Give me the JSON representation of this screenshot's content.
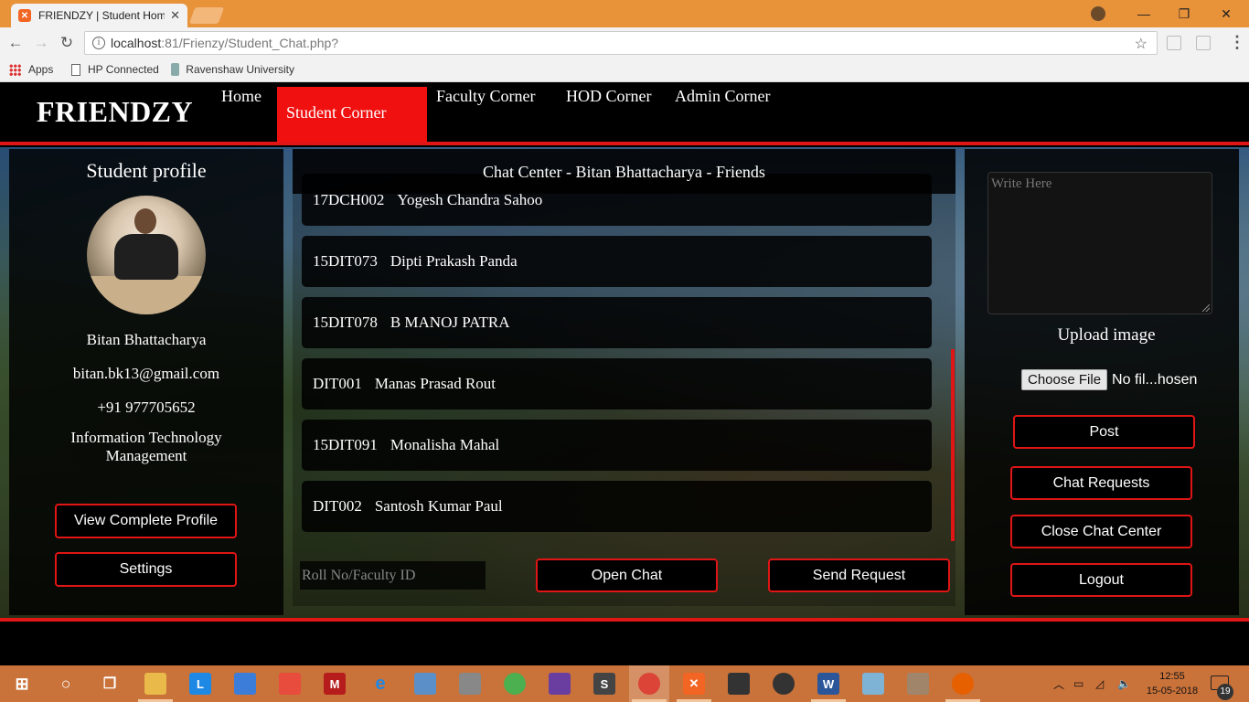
{
  "browser": {
    "tab_title": "FRIENDZY | Student Hom",
    "url_host": "localhost",
    "url_port_path": ":81/Frienzy/Student_Chat.php?",
    "bookmarks": [
      {
        "label": "Apps"
      },
      {
        "label": "HP Connected"
      },
      {
        "label": "Ravenshaw University"
      }
    ],
    "window_controls": {
      "minimize": "—",
      "restore": "❐",
      "close": "✕"
    }
  },
  "nav": {
    "brand": "FRIENDZY",
    "links": [
      "Home",
      "Student Corner",
      "Faculty Corner",
      "HOD Corner",
      "Admin Corner"
    ],
    "active": "Student Corner"
  },
  "profile": {
    "heading": "Student profile",
    "name": "Bitan Bhattacharya",
    "email": "bitan.bk13@gmail.com",
    "phone": "+91 977705652",
    "department": "Information Technology Management",
    "view_profile_label": "View Complete Profile",
    "settings_label": "Settings"
  },
  "chat": {
    "header": "Chat Center - Bitan Bhattacharya - Friends",
    "friends": [
      {
        "id": "17DCH002",
        "name": "Yogesh Chandra Sahoo"
      },
      {
        "id": "15DIT073",
        "name": "Dipti Prakash Panda"
      },
      {
        "id": "15DIT078",
        "name": "B MANOJ PATRA"
      },
      {
        "id": "DIT001",
        "name": "Manas Prasad Rout"
      },
      {
        "id": "15DIT091",
        "name": "Monalisha Mahal"
      },
      {
        "id": "DIT002",
        "name": "Santosh Kumar Paul"
      }
    ],
    "id_placeholder": "Roll No/Faculty ID",
    "open_chat_label": "Open Chat",
    "send_request_label": "Send Request"
  },
  "post": {
    "placeholder": "Write Here",
    "upload_label": "Upload image",
    "choose_file_label": "Choose File",
    "file_status": "No fil...hosen",
    "post_label": "Post",
    "chat_requests_label": "Chat Requests",
    "close_chat_label": "Close Chat Center",
    "logout_label": "Logout"
  },
  "taskbar": {
    "time": "12:55",
    "date": "15-05-2018",
    "notification_count": "19"
  },
  "colors": {
    "accent_red": "#e01515",
    "titlebar_orange": "#e8923a",
    "taskbar_orange": "#c9723a"
  }
}
